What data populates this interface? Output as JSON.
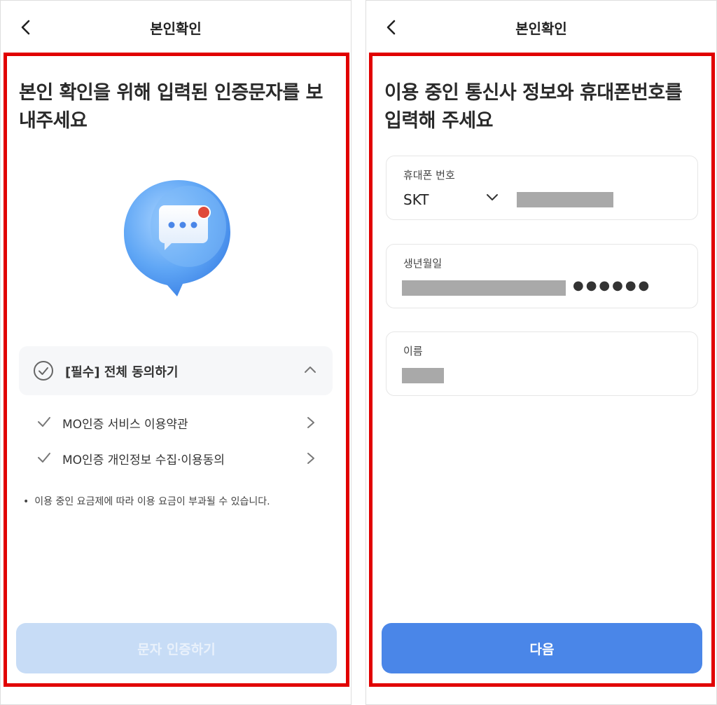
{
  "left": {
    "header": {
      "title": "본인확인"
    },
    "headline": "본인 확인을 위해 입력된 인증문자를 보내주세요",
    "agree_all": {
      "label": "[필수] 전체 동의하기"
    },
    "terms": [
      {
        "label": "MO인증 서비스 이용약관"
      },
      {
        "label": "MO인증 개인정보 수집·이용동의"
      }
    ],
    "notice": {
      "bullet": "•",
      "text": "이용 중인 요금제에 따라 이용 요금이 부과될 수 있습니다."
    },
    "button": {
      "label": "문자 인증하기",
      "enabled": false
    }
  },
  "right": {
    "header": {
      "title": "본인확인"
    },
    "headline": "이용 중인 통신사 정보와 휴대폰번호를 입력해 주세요",
    "phone": {
      "label": "휴대폰 번호",
      "carrier": "SKT"
    },
    "birth": {
      "label": "생년월일",
      "masked_suffix": "●●●●●●"
    },
    "name": {
      "label": "이름"
    },
    "button": {
      "label": "다음",
      "enabled": true
    }
  },
  "colors": {
    "primary": "#4a86e8",
    "primary_disabled": "#c7dcf6",
    "highlight_frame": "#e10000",
    "masked": "#a9a9a9",
    "notification_dot": "#e04a3a"
  }
}
